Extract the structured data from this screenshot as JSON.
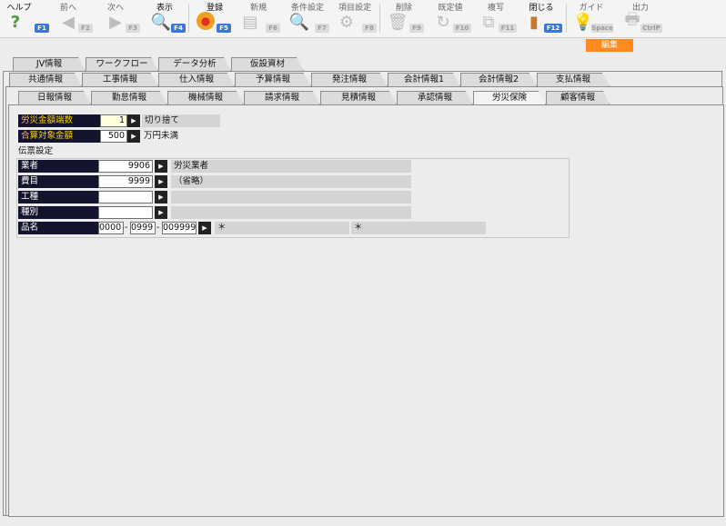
{
  "toolbar": {
    "help": {
      "label": "ヘルプ",
      "key": "F1"
    },
    "prev": {
      "label": "前へ",
      "key": "F2"
    },
    "next": {
      "label": "次へ",
      "key": "F3"
    },
    "display": {
      "label": "表示",
      "key": "F4"
    },
    "register": {
      "label": "登録",
      "key": "F5"
    },
    "new": {
      "label": "新規",
      "key": "F6"
    },
    "condition": {
      "label": "条件設定",
      "key": "F7"
    },
    "item_settings": {
      "label": "項目設定",
      "key": "F8"
    },
    "delete": {
      "label": "削除",
      "key": "F9"
    },
    "default": {
      "label": "既定値",
      "key": "F10"
    },
    "copy": {
      "label": "複写",
      "key": "F11"
    },
    "close": {
      "label": "閉じる",
      "key": "F12"
    },
    "guide": {
      "label": "ガイド",
      "key": "Space"
    },
    "output": {
      "label": "出力",
      "key": "CtrlP"
    },
    "edit_badge": "編集"
  },
  "tabs_row1": [
    "JV情報",
    "ワークフロー",
    "データ分析",
    "仮設資材"
  ],
  "tabs_row2": [
    "共通情報",
    "工事情報",
    "仕入情報",
    "予算情報",
    "発注情報",
    "会計情報1",
    "会計情報2",
    "支払情報"
  ],
  "tabs_row3": [
    "日報情報",
    "勤怠情報",
    "機械情報",
    "請求情報",
    "見積情報",
    "承認情報",
    "労災保険",
    "顧客情報"
  ],
  "active_tab": "労災保険",
  "form": {
    "rounding": {
      "label": "労災金額端数",
      "value": "1",
      "desc": "切り捨て"
    },
    "total_target": {
      "label": "合算対象金額",
      "value": "500",
      "suffix": "万円未満"
    },
    "slip_title": "伝票設定",
    "vendor": {
      "label": "業者",
      "value": "9906",
      "name": "労災業者"
    },
    "expense": {
      "label": "費目",
      "value": "9999",
      "name": "（省略）"
    },
    "work_type": {
      "label": "工種",
      "value": "",
      "name": ""
    },
    "category": {
      "label": "種別",
      "value": "",
      "name": ""
    },
    "product": {
      "label": "品名",
      "code1": "0000",
      "code2": "0999",
      "code3": "009999",
      "name1": "＊",
      "name2": "＊"
    }
  }
}
